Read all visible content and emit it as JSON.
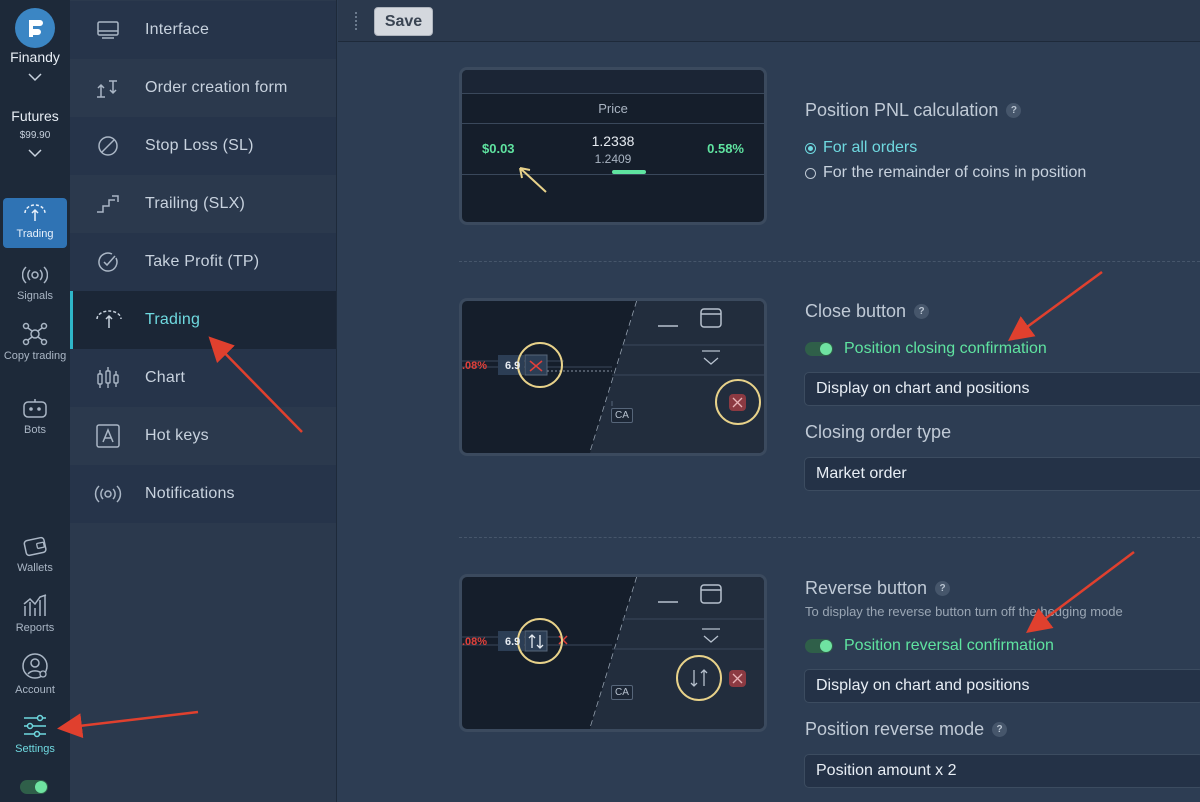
{
  "rail": {
    "brand": "Finandy",
    "market": "Futures",
    "balance": "$99.90",
    "items": [
      {
        "label": "Trading"
      },
      {
        "label": "Signals"
      },
      {
        "label": "Copy trading"
      },
      {
        "label": "Bots"
      },
      {
        "label": "Wallets"
      },
      {
        "label": "Reports"
      },
      {
        "label": "Account"
      },
      {
        "label": "Settings"
      }
    ]
  },
  "nav": {
    "items": [
      {
        "label": "Interface"
      },
      {
        "label": "Order creation form"
      },
      {
        "label": "Stop Loss (SL)"
      },
      {
        "label": "Trailing (SLX)"
      },
      {
        "label": "Take Profit (TP)"
      },
      {
        "label": "Trading"
      },
      {
        "label": "Chart"
      },
      {
        "label": "Hot keys"
      },
      {
        "label": "Notifications"
      }
    ],
    "active": "Trading"
  },
  "toolbar": {
    "save_label": "Save"
  },
  "pnl_section": {
    "title": "Position PNL calculation",
    "options": [
      {
        "label": "For all orders",
        "selected": true
      },
      {
        "label": "For the remainder of coins in position",
        "selected": false
      }
    ],
    "preview": {
      "header": "Price",
      "pnl": "$0.03",
      "price": "1.2338",
      "price2": "1.2409",
      "percent": "0.58%"
    }
  },
  "close_section": {
    "title": "Close button",
    "toggle_label": "Position closing confirmation",
    "display_value": "Display on chart and positions",
    "order_type_title": "Closing order type",
    "order_type_value": "Market order",
    "preview": {
      "percent": ".08%",
      "qty": "6.9",
      "tag": "CA"
    }
  },
  "reverse_section": {
    "title": "Reverse button",
    "hint": "To display the reverse button turn off the hedging mode",
    "toggle_label": "Position reversal confirmation",
    "display_value": "Display on chart and positions",
    "mode_title": "Position reverse mode",
    "mode_value": "Position amount x 2",
    "preview": {
      "percent": ".08%",
      "qty": "6.9",
      "tag": "CA"
    }
  },
  "colors": {
    "accent": "#6fd9e0",
    "green": "#5fe3a0",
    "red": "#e0403a",
    "active_rail": "#2f73b4"
  }
}
